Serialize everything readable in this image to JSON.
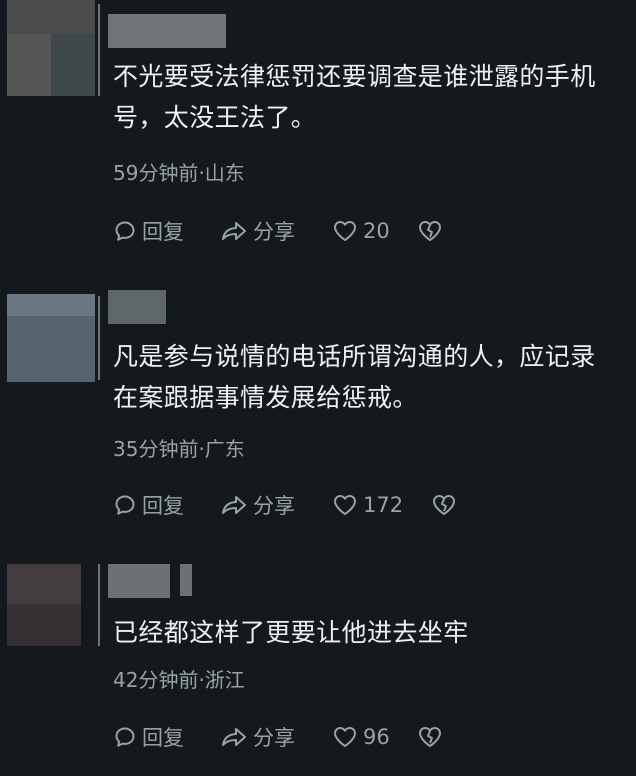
{
  "comments": [
    {
      "text_line1": "不光要受法律惩罚还要调查是谁泄露的手机",
      "text_line2": "号，太没王法了。",
      "meta": "59分钟前·山东",
      "reply_label": "回复",
      "share_label": "分享",
      "like_count": "20"
    },
    {
      "text_line1": "凡是参与说情的电话所谓沟通的人，应记录",
      "text_line2": "在案跟据事情发展给惩戒。",
      "meta": "35分钟前·广东",
      "reply_label": "回复",
      "share_label": "分享",
      "like_count": "172"
    },
    {
      "text_line1": "已经都这样了更要让他进去坐牢",
      "text_line2": "",
      "meta": "42分钟前·浙江",
      "reply_label": "回复",
      "share_label": "分享",
      "like_count": "96"
    }
  ],
  "icons": {
    "reply": "comment-bubble-icon",
    "share": "share-arrow-icon",
    "like": "heart-outline-icon",
    "dislike": "broken-heart-icon"
  },
  "colors": {
    "background": "#13191d",
    "text": "#eef2f3",
    "meta": "#98a2a7"
  }
}
